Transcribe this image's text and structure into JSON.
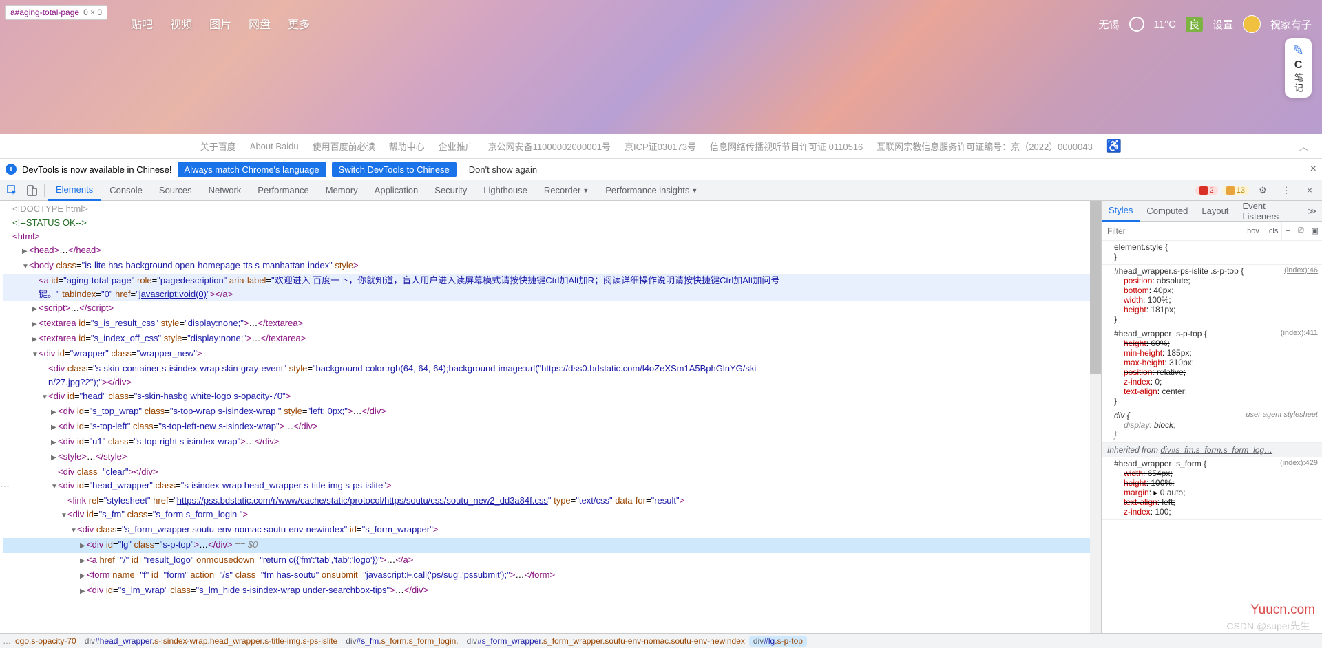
{
  "tooltip": {
    "selector": "a#aging-total-page",
    "dims": "0 × 0"
  },
  "top_nav": [
    "贴吧",
    "视频",
    "图片",
    "网盘",
    "更多"
  ],
  "weather": {
    "city": "无锡",
    "temp": "11°C",
    "aqi": "良"
  },
  "settings": "设置",
  "username": "祝家有子",
  "notes": {
    "label": "笔记"
  },
  "footer": [
    "关于百度",
    "About Baidu",
    "使用百度前必读",
    "帮助中心",
    "企业推广",
    "京公网安备11000002000001号",
    "京ICP证030173号",
    "信息网络传播视听节目许可证 0110516",
    "互联网宗教信息服务许可证编号：京（2022）0000043"
  ],
  "infobar": {
    "msg": "DevTools is now available in Chinese!",
    "btn1": "Always match Chrome's language",
    "btn2": "Switch DevTools to Chinese",
    "btn3": "Don't show again"
  },
  "tabs": [
    "Elements",
    "Console",
    "Sources",
    "Network",
    "Performance",
    "Memory",
    "Application",
    "Security",
    "Lighthouse",
    "Recorder",
    "Performance insights"
  ],
  "badges": {
    "err": "2",
    "warn": "13"
  },
  "dom": {
    "l0": "<!DOCTYPE html>",
    "l1": "<!--STATUS OK-->",
    "l2_open": "<html>",
    "l3": "<head>…</head>",
    "l4_body": "<body class=\"is-lite has-background open-homepage-tts s-manhattan-index\" style>",
    "l5_a": "<a id=\"aging-total-page\" role=\"pagedescription\" aria-label=\"欢迎进入 百度一下，你就知道，盲人用户进入读屏幕模式请按快捷键Ctrl加Alt加R；阅读详细操作说明请按快捷键Ctrl加Alt加问号键。\" tabindex=\"0\" href=\"javascript:void(0)\"></a>",
    "l6": "<script>…</script>",
    "l7": "<textarea id=\"s_is_result_css\" style=\"display:none;\">…</textarea>",
    "l8": "<textarea id=\"s_index_off_css\" style=\"display:none;\">…</textarea>",
    "l9": "<div id=\"wrapper\" class=\"wrapper_new\">",
    "l10": "<div class=\"s-skin-container s-isindex-wrap skin-gray-event\" style=\"background-color:rgb(64, 64, 64);background-image:url(\"https://dss0.bdstatic.com/l4oZeXSm1A5BphGlnYG/skin/27.jpg?2\");\"></div>",
    "l11": "<div id=\"head\" class=\"s-skin-hasbg white-logo s-opacity-70\">",
    "l12": "<div id=\"s_top_wrap\" class=\"s-top-wrap s-isindex-wrap \" style=\"left: 0px;\">…</div>",
    "l13": "<div id=\"s-top-left\" class=\"s-top-left-new s-isindex-wrap\">…</div>",
    "l14": "<div id=\"u1\" class=\"s-top-right s-isindex-wrap\">…</div>",
    "l15": "<style>…</style>",
    "l16": "<div class=\"clear\"></div>",
    "l17": "<div id=\"head_wrapper\" class=\"s-isindex-wrap head_wrapper s-title-img s-ps-islite\">",
    "l18": "<link rel=\"stylesheet\" href=\"https://pss.bdstatic.com/r/www/cache/static/protocol/https/soutu/css/soutu_new2_dd3a84f.css\" type=\"text/css\" data-for=\"result\">",
    "l19": "<div id=\"s_fm\" class=\"s_form s_form_login \">",
    "l20": "<div class=\"s_form_wrapper soutu-env-nomac soutu-env-newindex\" id=\"s_form_wrapper\">",
    "l21": "<div id=\"lg\" class=\"s-p-top\">…</div>",
    "l21_eq": "== $0",
    "l22": "<a href=\"/\" id=\"result_logo\" onmousedown=\"return c({'fm':'tab','tab':'logo'})\">…</a>",
    "l23": "<form name=\"f\" id=\"form\" action=\"/s\" class=\"fm  has-soutu\" onsubmit=\"javascript:F.call('ps/sug','pssubmit');\">…</form>",
    "l24": "<div id=\"s_lm_wrap\" class=\"s_lm_hide s-isindex-wrap under-searchbox-tips\">…</div>"
  },
  "styles_tabs": [
    "Styles",
    "Computed",
    "Layout",
    "Event Listeners"
  ],
  "filter_placeholder": "Filter",
  "filter_btns": [
    ":hov",
    ".cls",
    "+"
  ],
  "rules": {
    "r0": {
      "sel": "element.style {",
      "body": "}"
    },
    "r1": {
      "sel": "#head_wrapper.s-ps-islite .s-p-top {",
      "src": "(index):46",
      "p": [
        [
          "position",
          "absolute"
        ],
        [
          "bottom",
          "40px"
        ],
        [
          "width",
          "100%"
        ],
        [
          "height",
          "181px"
        ]
      ]
    },
    "r2": {
      "sel": "#head_wrapper .s-p-top {",
      "src": "(index):411",
      "p": [
        [
          "height",
          "60%",
          true
        ],
        [
          "min-height",
          "185px"
        ],
        [
          "max-height",
          "310px"
        ],
        [
          "position",
          "relative",
          true
        ],
        [
          "z-index",
          "0"
        ],
        [
          "text-align",
          "center"
        ]
      ]
    },
    "r3": {
      "sel": "div {",
      "src": "user agent stylesheet",
      "p": [
        [
          "display",
          "block"
        ]
      ]
    },
    "inherit": "Inherited from div#s_fm.s_form.s_form_log…",
    "r4": {
      "sel": "#head_wrapper .s_form {",
      "src": "(index):429",
      "p": [
        [
          "width",
          "654px",
          true
        ],
        [
          "height",
          "100%",
          true
        ],
        [
          "margin",
          "0 auto",
          true,
          "sw"
        ],
        [
          "text-align",
          "left",
          true
        ],
        [
          "z-index",
          "100",
          true
        ]
      ]
    }
  },
  "crumbs": {
    "pre": "…",
    "items": [
      "ogo.s-opacity-70",
      "div#head_wrapper.s-isindex-wrap.head_wrapper.s-title-img.s-ps-islite",
      "div#s_fm.s_form.s_form_login.",
      "div#s_form_wrapper.s_form_wrapper.soutu-env-nomac.soutu-env-newindex",
      "div#lg.s-p-top"
    ]
  },
  "watermark": {
    "w1": "Yuucn.com",
    "w2": "CSDN @super先生_"
  }
}
